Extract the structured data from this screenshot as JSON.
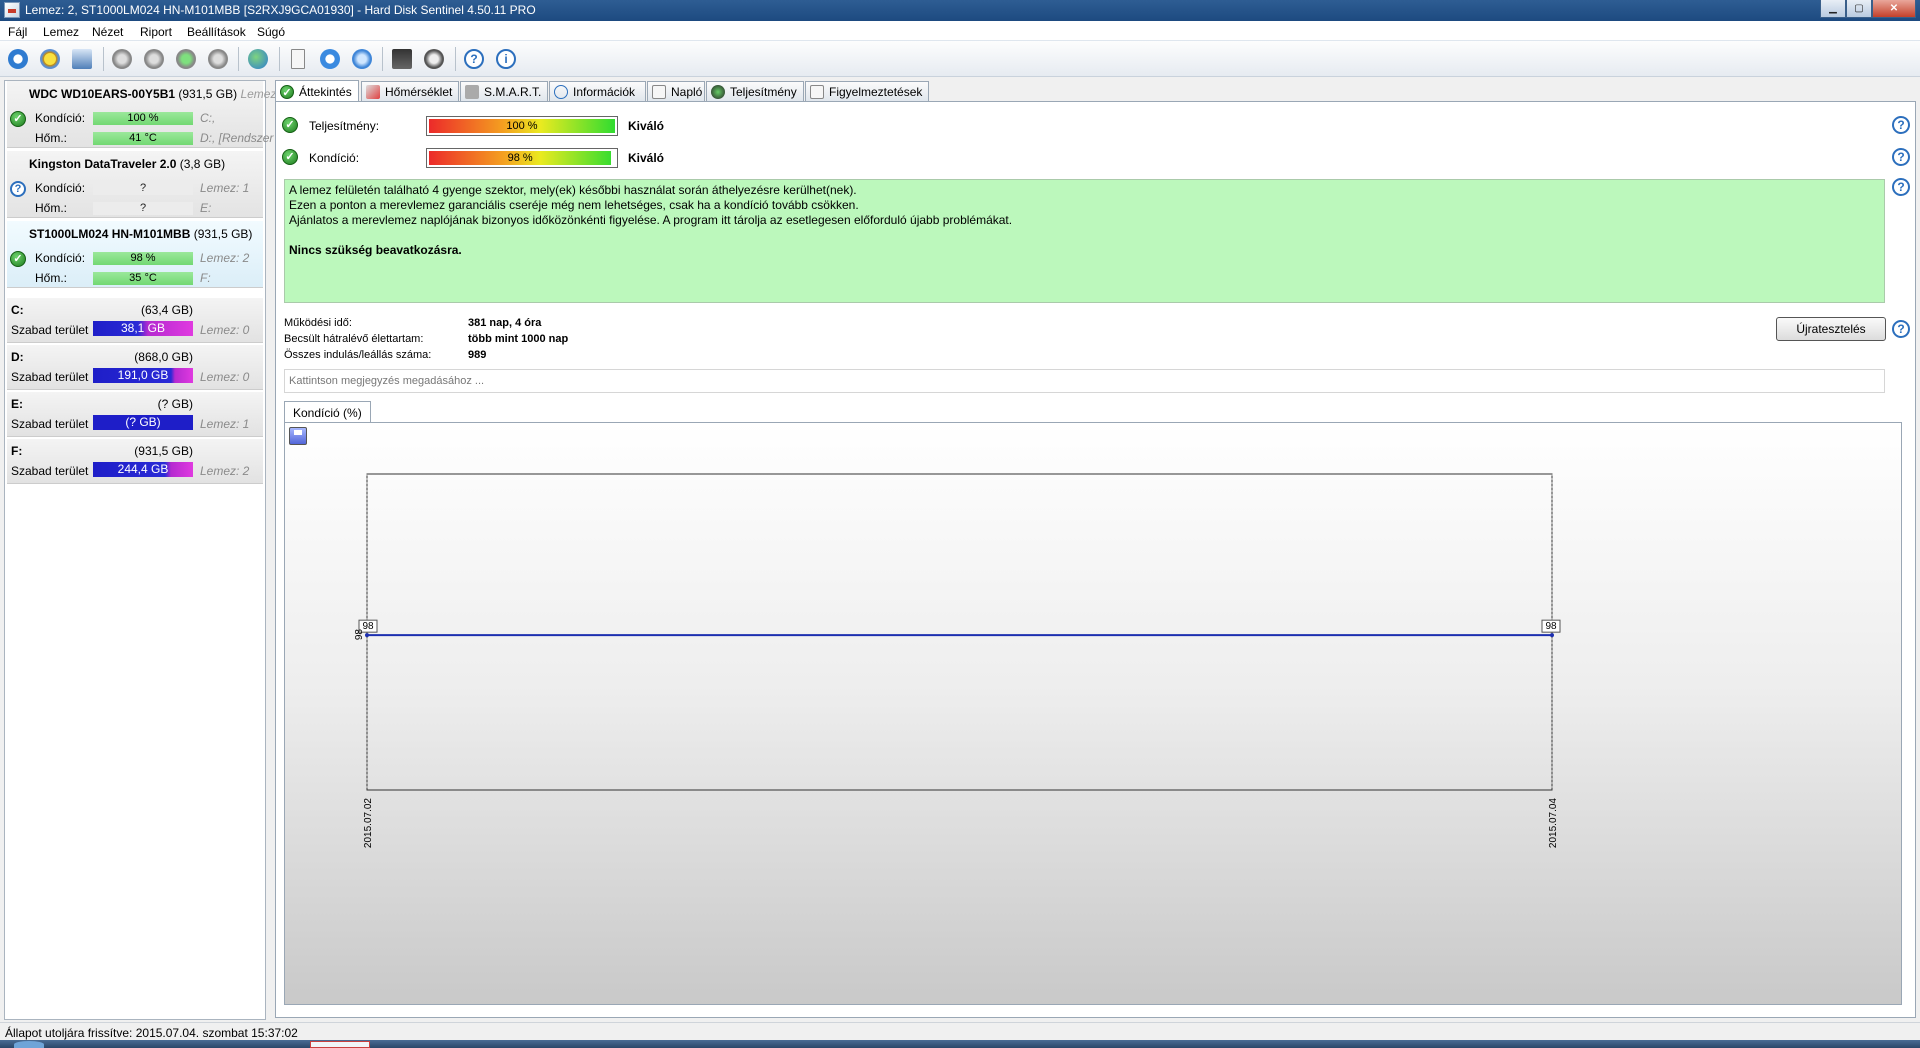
{
  "window": {
    "title": "Lemez: 2, ST1000LM024 HN-M101MBB [S2RXJ9GCA01930]  -  Hard Disk Sentinel 4.50.11 PRO"
  },
  "menu": [
    "Fájl",
    "Lemez",
    "Nézet",
    "Riport",
    "Beállítások",
    "Súgó"
  ],
  "toolbar": {
    "icons": [
      "refresh-icon",
      "warning-icon",
      "report-icon",
      "disk-test-icon",
      "disk-test2-icon",
      "disk-ok-icon",
      "disk-tool-icon",
      "globe-icon",
      "document-icon",
      "sync-icon",
      "network-icon",
      "monitor-icon",
      "speaker-icon",
      "help-icon",
      "info-icon"
    ]
  },
  "disks": [
    {
      "name": "WDC WD10EARS-00Y5B1",
      "size": "(931,5 GB)",
      "extra": "Lemez",
      "status": "ok",
      "kondicio_label": "Kondíció:",
      "kondicio": "100 %",
      "hom_label": "Hőm.:",
      "hom": "41 °C",
      "side1": "C:,",
      "side2": "D:, [Rendszer"
    },
    {
      "name": "Kingston DataTraveler 2.0",
      "size": "(3,8 GB)",
      "extra": "",
      "status": "unknown",
      "kondicio_label": "Kondíció:",
      "kondicio": "?",
      "hom_label": "Hőm.:",
      "hom": "?",
      "side1": "Lemez: 1",
      "side2": "E:"
    },
    {
      "name": "ST1000LM024 HN-M101MBB",
      "size": "(931,5 GB)",
      "extra": "",
      "status": "ok",
      "kondicio_label": "Kondíció:",
      "kondicio": "98 %",
      "hom_label": "Hőm.:",
      "hom": "35 °C",
      "side1": "Lemez: 2",
      "side2": "F:"
    }
  ],
  "volumes": [
    {
      "name": "C:",
      "size": "(63,4 GB)",
      "free_label": "Szabad terület",
      "free": "38,1 GB",
      "free_pct": 60,
      "disk": "Lemez: 0"
    },
    {
      "name": "D:",
      "size": "(868,0 GB)",
      "free_label": "Szabad terület",
      "free": "191,0 GB",
      "free_pct": 22,
      "disk": "Lemez: 0"
    },
    {
      "name": "E:",
      "size": "(? GB)",
      "free_label": "Szabad terület",
      "free": "(? GB)",
      "free_pct": 100,
      "disk": "Lemez: 1"
    },
    {
      "name": "F:",
      "size": "(931,5 GB)",
      "free_label": "Szabad terület",
      "free": "244,4 GB",
      "free_pct": 26,
      "disk": "Lemez: 2"
    }
  ],
  "tabs": [
    "Áttekintés",
    "Hőmérséklet",
    "S.M.A.R.T.",
    "Információk",
    "Napló",
    "Teljesítmény",
    "Figyelmeztetések"
  ],
  "overview": {
    "perf_label": "Teljesítmény:",
    "perf_value": "100 %",
    "perf_pct": 100,
    "perf_rating": "Kiváló",
    "health_label": "Kondíció:",
    "health_value": "98 %",
    "health_pct": 98,
    "health_rating": "Kiváló",
    "info_lines": [
      "A lemez felületén található 4 gyenge szektor, mely(ek) későbbi használat során áthelyezésre kerülhet(nek).",
      "Ezen a ponton a merevlemez garanciális cseréje még nem lehetséges, csak ha a kondíció tovább csökken.",
      "Ajánlatos a merevlemez naplójának bizonyos időközönkénti figyelése. A program itt tárolja az esetlegesen előforduló újabb problémákat."
    ],
    "info_bold": "Nincs szükség beavatkozásra.",
    "uptime_label": "Működési idő:",
    "uptime": "381 nap, 4 óra",
    "lifetime_label": "Becsült hátralévő élettartam:",
    "lifetime": "több mint 1000 nap",
    "starts_label": "Összes indulás/leállás száma:",
    "starts": "989",
    "retest_label": "Újratesztelés",
    "note_placeholder": "Kattintson megjegyzés megadásához ..."
  },
  "chart_data": {
    "type": "line",
    "title": "Kondíció  (%)",
    "x": [
      "2015.07.02",
      "2015.07.04"
    ],
    "series": [
      {
        "values": [
          98,
          98
        ]
      }
    ],
    "ytick": "98"
  },
  "status": {
    "text": "Állapot utoljára frissítve: 2015.07.04. szombat 15:37:02"
  }
}
